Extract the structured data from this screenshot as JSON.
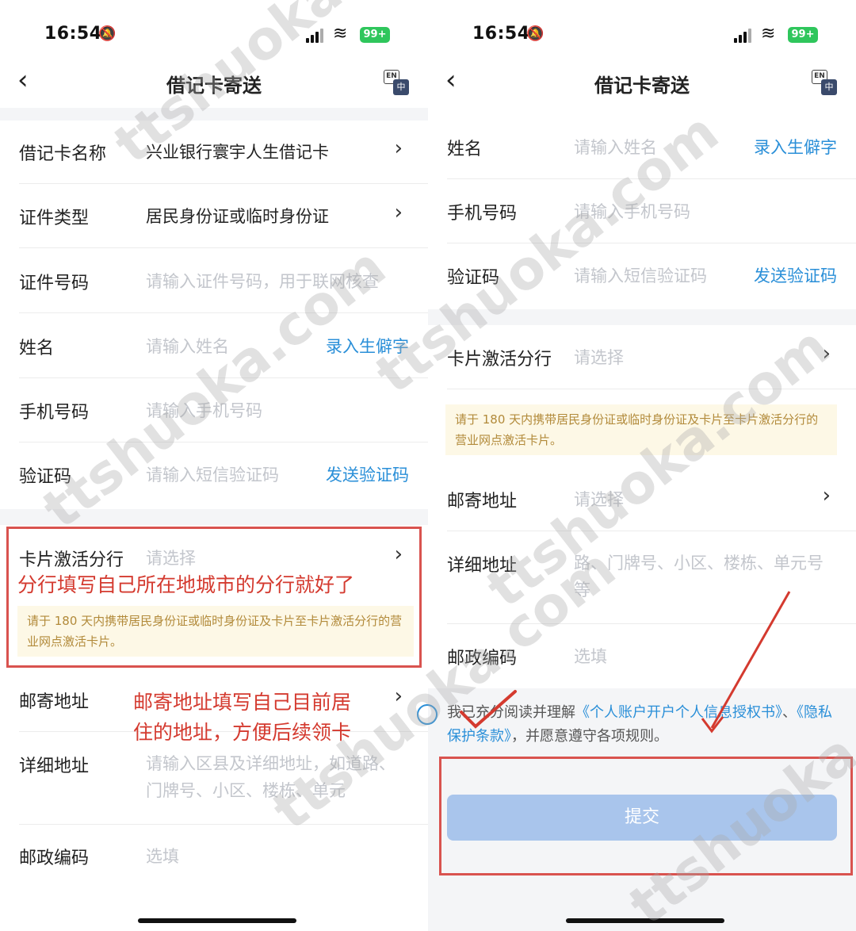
{
  "status": {
    "time": "16:54",
    "battery": "99+"
  },
  "nav": {
    "title": "借记卡寄送",
    "lang_en": "EN",
    "lang_zh": "中"
  },
  "left": {
    "rows": {
      "card_name": {
        "label": "借记卡名称",
        "value": "兴业银行寰宇人生借记卡"
      },
      "id_type": {
        "label": "证件类型",
        "value": "居民身份证或临时身份证"
      },
      "id_number": {
        "label": "证件号码",
        "placeholder": "请输入证件号码，用于联网核查"
      },
      "name": {
        "label": "姓名",
        "placeholder": "请输入姓名",
        "link": "录入生僻字"
      },
      "phone": {
        "label": "手机号码",
        "placeholder": "请输入手机号码"
      },
      "code": {
        "label": "验证码",
        "placeholder": "请输入短信验证码",
        "link": "发送验证码"
      },
      "branch": {
        "label": "卡片激活分行",
        "placeholder": "请选择"
      },
      "mail": {
        "label": "邮寄地址"
      },
      "detail": {
        "label": "详细地址",
        "placeholder": "请输入区县及详细地址，如道路、门牌号、小区、楼栋、单元"
      },
      "post": {
        "label": "邮政编码",
        "placeholder": "选填"
      }
    },
    "notice": "请于 180 天内携带居民身份证或临时身份证及卡片至卡片激活分行的营业网点激活卡片。",
    "annotation_branch": "分行填写自己所在地城市的分行就好了",
    "annotation_mail_1": "邮寄地址填写自己目前居",
    "annotation_mail_2": "住的地址，方便后续领卡"
  },
  "right": {
    "rows": {
      "name": {
        "label": "姓名",
        "placeholder": "请输入姓名",
        "link": "录入生僻字"
      },
      "phone": {
        "label": "手机号码",
        "placeholder": "请输入手机号码"
      },
      "code": {
        "label": "验证码",
        "placeholder": "请输入短信验证码",
        "link": "发送验证码"
      },
      "branch": {
        "label": "卡片激活分行",
        "placeholder": "请选择"
      },
      "mail": {
        "label": "邮寄地址",
        "placeholder": "请选择"
      },
      "detail": {
        "label": "详细地址",
        "placeholder": "路、门牌号、小区、楼栋、单元号等"
      },
      "post": {
        "label": "邮政编码",
        "placeholder": "选填"
      }
    },
    "notice": "请于 180 天内携带居民身份证或临时身份证及卡片至卡片激活分行的营业网点激活卡片。",
    "agree_prefix": "我已充分阅读并理解",
    "agree_link1": "《个人账户开户个人信息授权书》",
    "agree_sep": "、",
    "agree_link2": "《隐私保护条款》",
    "agree_suffix": "，并愿意遵守各项规则。",
    "submit": "提交"
  },
  "watermark": "ttshuoka.com",
  "colors": {
    "link": "#2a8fd8",
    "annotation": "#d43a2f",
    "submit": "#a9c5ec",
    "notice_bg": "#fdf8e6"
  }
}
